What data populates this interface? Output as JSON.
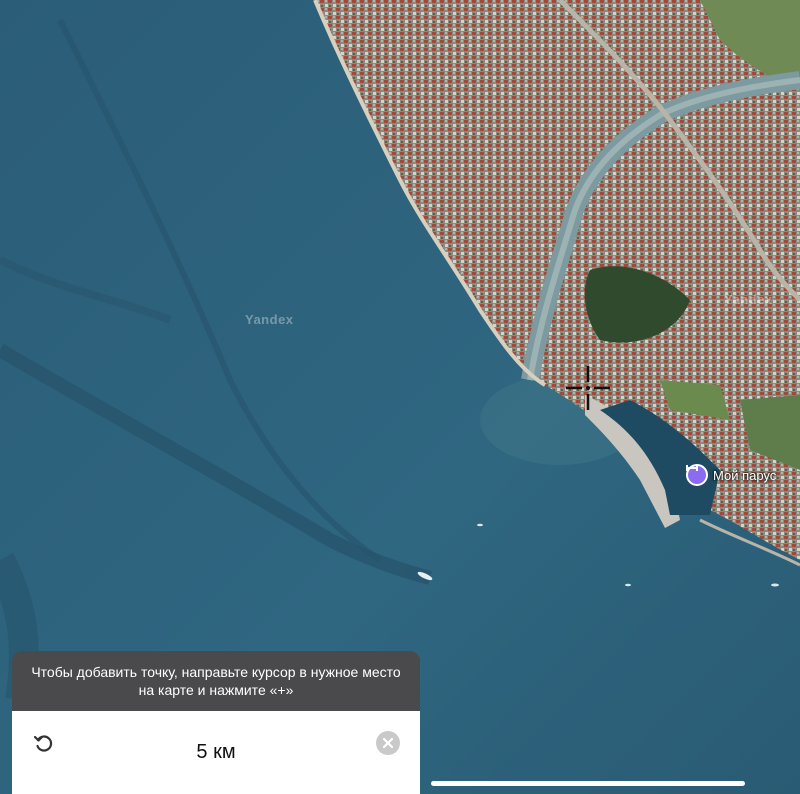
{
  "map": {
    "watermark": "Yandex",
    "watermark_small": "Yandex",
    "poi": {
      "label": "Мой парус",
      "icon": "dumbbell-icon",
      "color": "#8a6cf0"
    }
  },
  "panel": {
    "hint": "Чтобы добавить точку, направьте курсор в нужное место на карте и нажмите «+»",
    "distance": "5 км",
    "undo_icon": "undo-icon",
    "close_icon": "close-icon"
  },
  "colors": {
    "sea": "#2d5a73",
    "hint_bg": "#4a4a4c",
    "poi": "#8a6cf0"
  }
}
